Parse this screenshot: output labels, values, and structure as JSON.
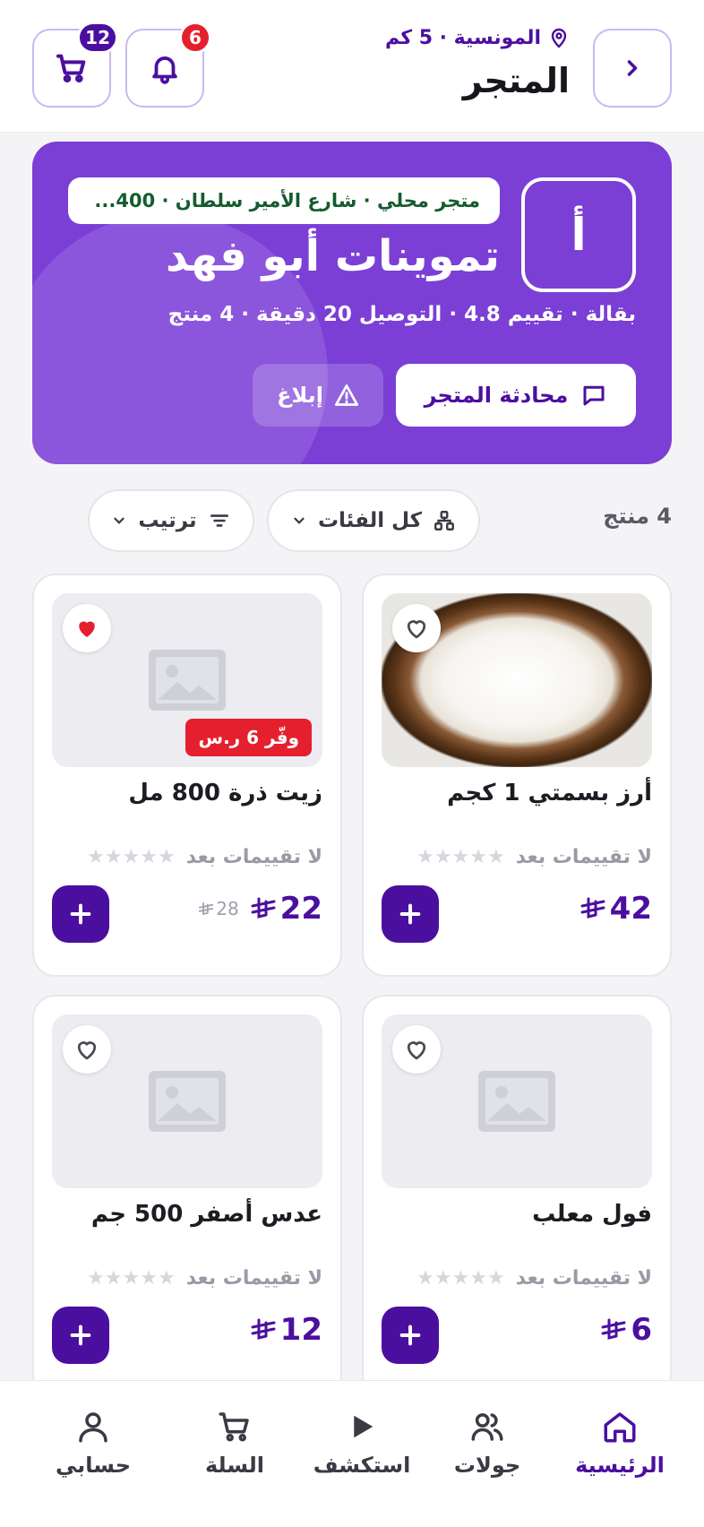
{
  "header": {
    "title": "المتجر",
    "location": "المونسية · 5 كم",
    "notifications_count": "6",
    "cart_count": "12"
  },
  "store": {
    "logo_letter": "أ",
    "address": "متجر محلي · شارع الأمير سلطان · 400...",
    "name": "تموينات أبو فهد",
    "meta": "بقالة · تقييم 4.8 · التوصيل 20 دقيقة · 4 منتج",
    "chat_label": "محادثة المتجر",
    "report_label": "إبلاغ"
  },
  "filters": {
    "count_label": "4 منتج",
    "category_label": "كل الفئات",
    "sort_label": "ترتيب"
  },
  "products": [
    {
      "name": "أرز بسمتي 1 كجم",
      "price": "42",
      "rating_text": "لا تقييمات بعد",
      "favorite": false,
      "has_photo": true
    },
    {
      "name": "زيت ذرة 800 مل",
      "price": "22",
      "old_price": "28",
      "discount": "وفّر 6 ر.س",
      "rating_text": "لا تقييمات بعد",
      "favorite": true,
      "has_photo": false
    },
    {
      "name": "فول معلب",
      "price": "6",
      "rating_text": "لا تقييمات بعد",
      "favorite": false,
      "has_photo": false
    },
    {
      "name": "عدس أصفر 500 جم",
      "price": "12",
      "rating_text": "لا تقييمات بعد",
      "favorite": false,
      "has_photo": false
    }
  ],
  "nav": {
    "home": "الرئيسية",
    "tours": "جولات",
    "explore": "استكشف",
    "cart": "السلة",
    "account": "حسابي"
  },
  "colors": {
    "brand": "#4b0fa0",
    "card": "#7b3fd6",
    "sale": "#e5202e"
  }
}
